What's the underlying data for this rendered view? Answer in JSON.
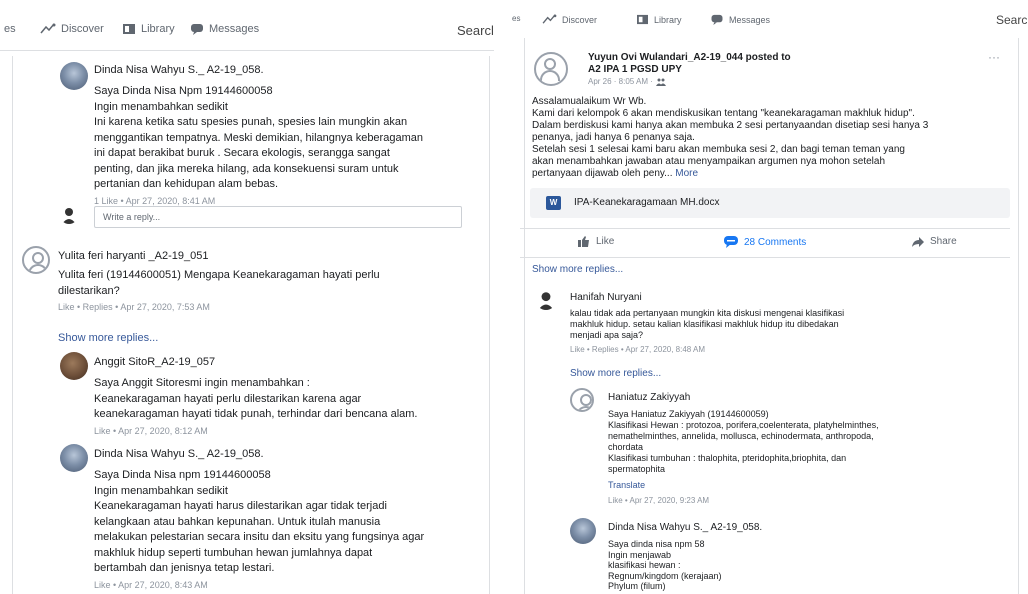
{
  "left": {
    "nav": {
      "truncated": "es",
      "discover": "Discover",
      "library": "Library",
      "messages": "Messages",
      "search": "Searcl"
    },
    "c1": {
      "name": "Dinda Nisa Wahyu S._ A2-19_058.",
      "text": "Saya Dinda Nisa Npm 19144600058\nIngin menambahkan sedikit\nIni karena ketika satu spesies punah, spesies lain mungkin akan\nmenggantikan tempatnya. Meski demikian, hilangnya keberagaman\nini dapat berakibat buruk . Secara ekologis, serangga sangat\npenting, dan jika mereka hilang, ada konsekuensi suram untuk\npertanian dan kehidupan alam bebas.",
      "meta": "1 Like  •  Apr 27, 2020, 8:41 AM"
    },
    "reply_placeholder": "Write a reply...",
    "c2": {
      "name": "Yulita feri haryanti _A2-19_051",
      "text": "Yulita feri (19144600051) Mengapa Keanekaragaman hayati perlu\ndilestarikan?",
      "meta": "Like  •  Replies  •  Apr 27, 2020, 7:53 AM"
    },
    "show_more": "Show more replies...",
    "c3": {
      "name": "Anggit SitoR_A2-19_057",
      "text": "Saya Anggit Sitoresmi ingin menambahkan :\nKeanekaragaman hayati perlu dilestarikan karena agar\nkeanekaragaman hayati tidak punah, terhindar dari bencana alam.",
      "meta": "Like  •  Apr 27, 2020, 8:12 AM"
    },
    "c4": {
      "name": "Dinda Nisa Wahyu S._ A2-19_058.",
      "text": "Saya Dinda Nisa npm 19144600058\nIngin menambahkan sedikit\nKeanekaragaman hayati harus dilestarikan agar tidak terjadi\nkelangkaan atau bahkan kepunahan. Untuk itulah manusia\nmelakukan pelestarian secara insitu dan eksitu yang fungsinya agar\nmakhluk hidup seperti tumbuhan hewan jumlahnya dapat\nbertambah dan jenisnya tetap lestari.",
      "meta": "Like  •  Apr 27, 2020, 8:43 AM"
    }
  },
  "right": {
    "nav": {
      "truncated": "es",
      "discover": "Discover",
      "library": "Library",
      "messages": "Messages",
      "search": "Searc"
    },
    "post": {
      "author_line": "Yuyun Ovi Wulandari_A2-19_044 posted to",
      "group": "A2 IPA 1 PGSD UPY",
      "date": "Apr 26 · 8:05 AM ·",
      "more": "···",
      "text": "Assalamualaikum Wr Wb.\nKami dari kelompok 6 akan mendiskusikan tentang \"keanekaragaman makhluk hidup\".\nDalam berdiskusi kami hanya akan membuka 2 sesi pertanyaandan disetiap sesi hanya 3\npenanya, jadi hanya 6 penanya saja.\nSetelah sesi 1 selesai kami baru akan membuka sesi 2, dan bagi teman teman yang\nakan menambahkan jawaban atau menyampaikan argumen nya mohon setelah\npertanyaan dijawab oleh peny...",
      "more_link": "More",
      "attachment": "IPA-Keanekaragamaan MH.docx",
      "doc_letter": "W"
    },
    "actions": {
      "like": "Like",
      "comments": "28 Comments",
      "share": "Share"
    },
    "show_more_top": "Show more replies...",
    "c1": {
      "name": "Hanifah Nuryani",
      "text": "kalau tidak ada pertanyaan mungkin kita diskusi mengenai klasifikasi\nmakhluk hidup. setau kalian klasifikasi makhluk hidup itu dibedakan\nmenjadi apa saja?",
      "meta": "Like  •  Replies  •  Apr 27, 2020, 8:48 AM"
    },
    "show_more": "Show more replies...",
    "c2": {
      "name": "Haniatuz Zakiyyah",
      "text": "Saya Haniatuz Zakiyyah (19144600059)\nKlasifikasi Hewan : protozoa, porifera,coelenterata, platyhelminthes,\nnemathelminthes, annelida, mollusca, echinodermata, anthropoda,\nchordata\nKlasifikasi tumbuhan : thalophita, pteridophita,briophita, dan\nspermatophita",
      "translate": "Translate",
      "meta": "Like  •  Apr 27, 2020, 9:23 AM"
    },
    "c3": {
      "name": "Dinda Nisa Wahyu S._ A2-19_058.",
      "text": "Saya dinda nisa npm 58\nIngin menjawab\nklasifikasi hewan :\nRegnum/kingdom (kerajaan)\nPhylum (filum)"
    }
  },
  "colors": {
    "link": "#365899",
    "meta": "#8d949e",
    "border": "#dddfe2",
    "comments_icon": "#1877f2"
  }
}
